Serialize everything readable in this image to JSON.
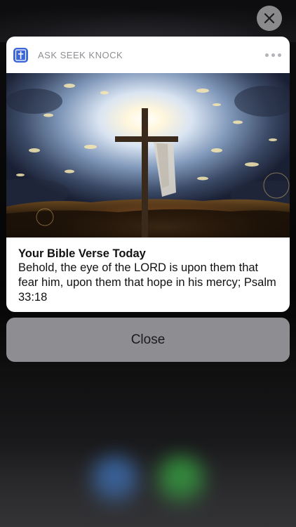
{
  "notification": {
    "app_name": "ASK SEEK KNOCK",
    "app_icon": "cross-book-icon",
    "more_icon": "ellipsis-icon",
    "image_icon": "cross-sunset-image",
    "title": "Your Bible Verse Today",
    "body": "Behold, the eye of the LORD is upon them that fear him, upon them that hope in his mercy; Psalm 33:18"
  },
  "actions": {
    "close_label": "Close",
    "dismiss_icon": "close-icon"
  },
  "colors": {
    "app_icon_bg": "#3d67d8",
    "action_bg": "#8e8e92",
    "dismiss_bg": "#8a8a8c"
  }
}
